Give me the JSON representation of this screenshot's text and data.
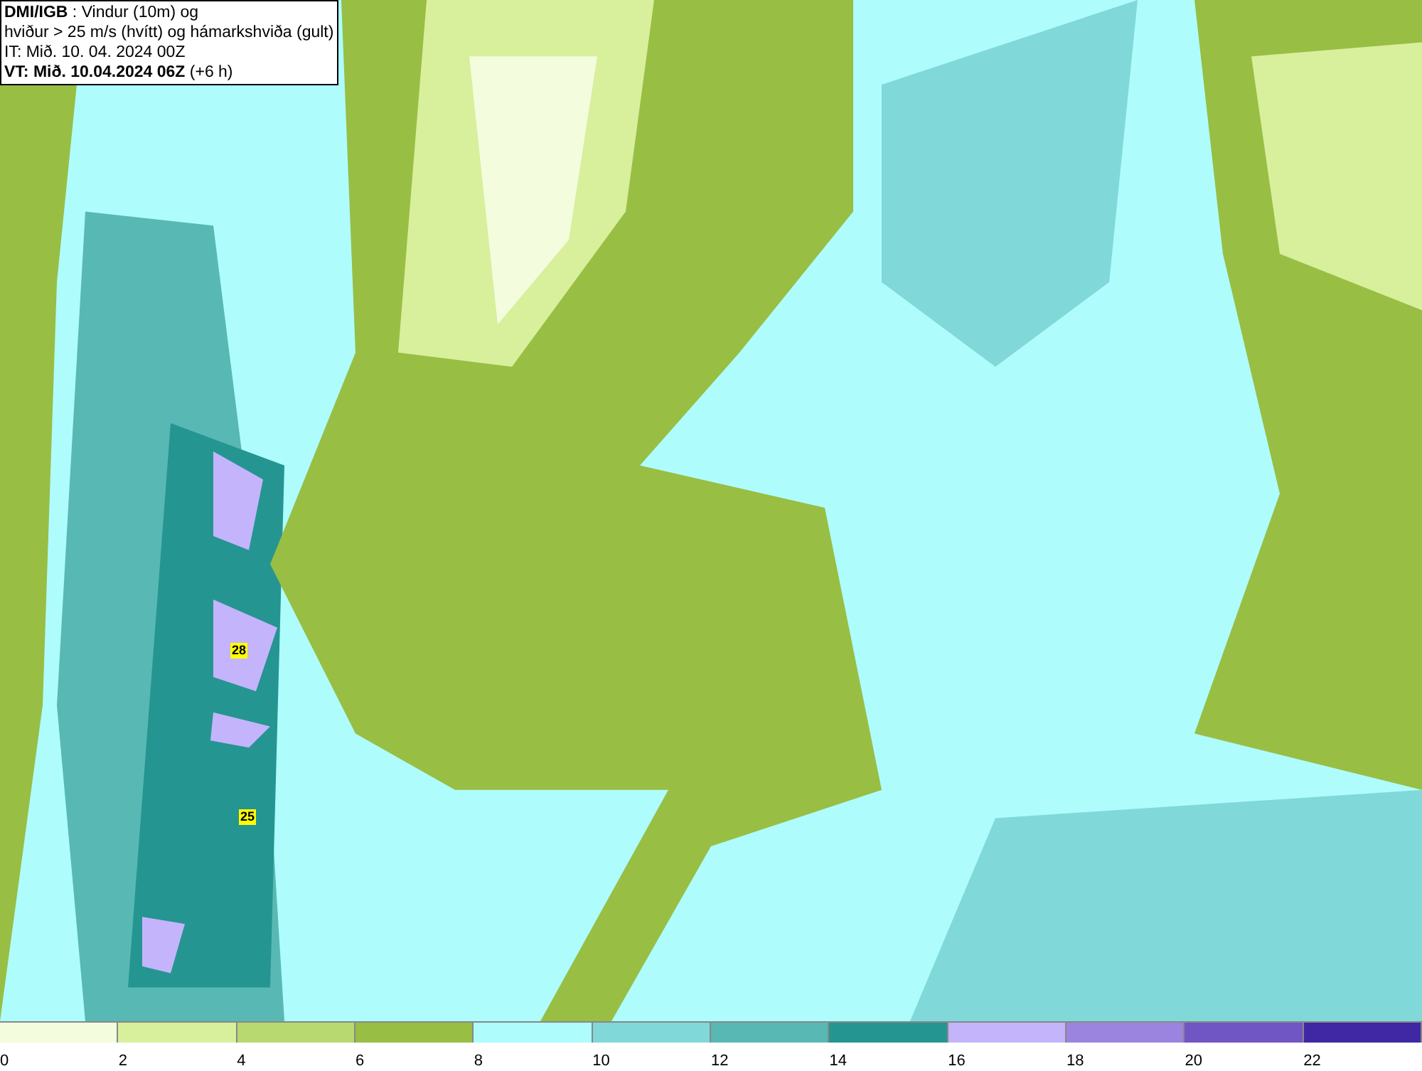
{
  "title_box": {
    "lines": [
      "**DMI/IGB** : Vindur (10m) og",
      "hviður > 25 m/s (hvítt) og hámarkshviða (gult)",
      "IT: Mið. 10. 04. 2024 00Z",
      "**VT: Mið. 10.04.2024 06Z** (+6 h)"
    ]
  },
  "map": {
    "gust_markers": [
      {
        "label": "28"
      },
      {
        "label": "25"
      }
    ]
  },
  "legend": {
    "bins": [
      {
        "label": "0",
        "color": "#f4fcde"
      },
      {
        "label": "2",
        "color": "#d8ef9c"
      },
      {
        "label": "4",
        "color": "#b7d96f"
      },
      {
        "label": "6",
        "color": "#98be44"
      },
      {
        "label": "8",
        "color": "#aefcfc"
      },
      {
        "label": "10",
        "color": "#80d8d8"
      },
      {
        "label": "12",
        "color": "#58b8b4"
      },
      {
        "label": "14",
        "color": "#259591"
      },
      {
        "label": "16",
        "color": "#c4b4fc"
      },
      {
        "label": "18",
        "color": "#9a84e0"
      },
      {
        "label": "20",
        "color": "#7056c4"
      },
      {
        "label": "22",
        "color": "#4028a4"
      }
    ]
  }
}
